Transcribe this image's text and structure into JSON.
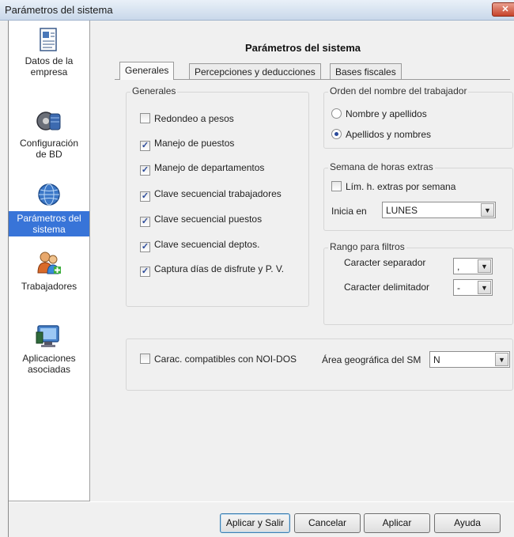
{
  "window": {
    "title": "Parámetros del sistema",
    "close_glyph": "✕"
  },
  "sidebar": {
    "items": [
      {
        "label": "Datos de la empresa",
        "icon": "document-icon"
      },
      {
        "label": "Configuración de BD",
        "icon": "database-config-icon"
      },
      {
        "label": "Parámetros del sistema",
        "icon": "globe-icon",
        "selected": true
      },
      {
        "label": "Trabajadores",
        "icon": "workers-icon"
      },
      {
        "label": "Aplicaciones asociadas",
        "icon": "applications-icon"
      }
    ]
  },
  "main": {
    "title": "Parámetros del sistema",
    "tabs": [
      {
        "label": "Generales",
        "active": true
      },
      {
        "label": "Percepciones y deducciones"
      },
      {
        "label": "Bases fiscales"
      }
    ],
    "generales": {
      "group_label": "Generales",
      "options": [
        {
          "label": "Redondeo a pesos",
          "checked": false
        },
        {
          "label": "Manejo de puestos",
          "checked": true
        },
        {
          "label": "Manejo de departamentos",
          "checked": true
        },
        {
          "label": "Clave secuencial trabajadores",
          "checked": true
        },
        {
          "label": "Clave secuencial puestos",
          "checked": true
        },
        {
          "label": "Clave secuencial deptos.",
          "checked": true
        },
        {
          "label": "Captura días de disfrute y  P. V.",
          "checked": true
        }
      ]
    },
    "orden": {
      "group_label": "Orden del nombre del trabajador",
      "options": [
        {
          "label": "Nombre y apellidos",
          "selected": false
        },
        {
          "label": "Apellidos y nombres",
          "selected": true
        }
      ]
    },
    "semana": {
      "group_label": "Semana de horas extras",
      "limit_label": "Lím. h. extras por semana",
      "limit_checked": false,
      "start_label": "Inicia en",
      "start_value": "LUNES"
    },
    "rango": {
      "group_label": "Rango para filtros",
      "separator_label": "Caracter separador",
      "separator_value": ",",
      "delimiter_label": "Caracter delimitador",
      "delimiter_value": "-"
    },
    "compat": {
      "label": "Carac. compatibles con NOI-DOS",
      "checked": false,
      "area_label": "Área geográfica del SM",
      "area_value": "N"
    }
  },
  "footer": {
    "apply_exit": "Aplicar y Salir",
    "cancel": "Cancelar",
    "apply": "Aplicar",
    "help": "Ayuda"
  },
  "colors": {
    "selection": "#3874d8",
    "check": "#2a4a9a"
  }
}
